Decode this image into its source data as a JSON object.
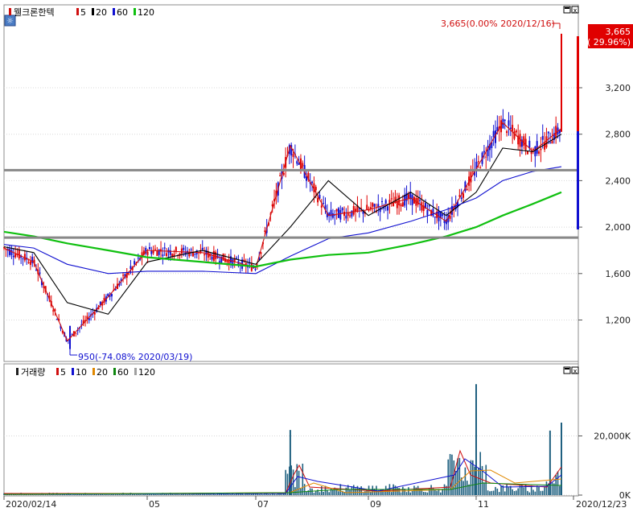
{
  "price_panel": {
    "title": "웰크론한텍",
    "legend": [
      {
        "label": "5",
        "color": "#d01010"
      },
      {
        "label": "20",
        "color": "#000000"
      },
      {
        "label": "60",
        "color": "#1010d0"
      },
      {
        "label": "120",
        "color": "#10c010"
      }
    ],
    "high_annotation": "3,665(0.00% 2020/12/16)",
    "low_annotation": "950(-74.08% 2020/03/19)",
    "current_price": "3,665",
    "current_change": "( 29.96%)"
  },
  "volume_panel": {
    "title": "거래량",
    "legend": [
      {
        "label": "5",
        "color": "#d01010"
      },
      {
        "label": "10",
        "color": "#1010d0"
      },
      {
        "label": "20",
        "color": "#e08800"
      },
      {
        "label": "60",
        "color": "#108810"
      },
      {
        "label": "120",
        "color": "#a0a0a0"
      }
    ]
  },
  "chart_data": [
    {
      "type": "line",
      "title": "웰크론한텍",
      "y_ticks": [
        "3,200",
        "2,800",
        "2,400",
        "2,000",
        "1,600",
        "1,200"
      ],
      "ylim": [
        850,
        3900
      ],
      "x_ticks": [
        "2020/02/14",
        "05",
        "07",
        "09",
        "11",
        "2020/12/23"
      ],
      "horizontal_lines": [
        2490,
        1910
      ],
      "high": 3665,
      "low": 950,
      "series": [
        {
          "name": "5",
          "color": "#d01010",
          "x": [
            "02/14",
            "03/01",
            "03/19",
            "04/10",
            "05/01",
            "06/01",
            "07/01",
            "07/20",
            "08/10",
            "09/01",
            "09/25",
            "10/15",
            "11/01",
            "11/15",
            "12/01",
            "12/16"
          ],
          "values": [
            1820,
            1700,
            1020,
            1400,
            1800,
            1780,
            1650,
            2700,
            2100,
            2150,
            2250,
            2050,
            2500,
            2900,
            2650,
            2850
          ]
        },
        {
          "name": "20",
          "color": "#000000",
          "x": [
            "02/14",
            "03/01",
            "03/19",
            "04/10",
            "05/01",
            "06/01",
            "07/01",
            "07/20",
            "08/10",
            "09/01",
            "09/25",
            "10/15",
            "11/01",
            "11/15",
            "12/01",
            "12/16"
          ],
          "values": [
            1830,
            1780,
            1350,
            1250,
            1700,
            1800,
            1680,
            2000,
            2400,
            2100,
            2300,
            2100,
            2300,
            2680,
            2650,
            2800
          ]
        },
        {
          "name": "60",
          "color": "#1010d0",
          "x": [
            "02/14",
            "03/01",
            "03/19",
            "04/10",
            "05/01",
            "06/01",
            "07/01",
            "07/20",
            "08/10",
            "09/01",
            "09/25",
            "10/15",
            "11/01",
            "11/15",
            "12/01",
            "12/16"
          ],
          "values": [
            1850,
            1820,
            1680,
            1600,
            1620,
            1620,
            1600,
            1750,
            1900,
            1950,
            2050,
            2150,
            2250,
            2400,
            2480,
            2520
          ]
        },
        {
          "name": "120",
          "color": "#10c010",
          "x": [
            "02/14",
            "03/01",
            "03/19",
            "04/10",
            "05/01",
            "06/01",
            "07/01",
            "07/20",
            "08/10",
            "09/01",
            "09/25",
            "10/15",
            "11/01",
            "11/15",
            "12/01",
            "12/16"
          ],
          "values": [
            1960,
            1920,
            1860,
            1800,
            1740,
            1700,
            1660,
            1720,
            1760,
            1780,
            1850,
            1920,
            2000,
            2100,
            2200,
            2300
          ]
        }
      ]
    },
    {
      "type": "bar",
      "title": "거래량",
      "y_ticks": [
        "20,000K",
        "0K"
      ],
      "ylim": [
        0,
        40000
      ],
      "volume_spikes": [
        {
          "x": "07/20",
          "value": 22000
        },
        {
          "x": "11/01",
          "value": 37500
        },
        {
          "x": "12/10",
          "value": 21800
        },
        {
          "x": "12/16",
          "value": 24500
        }
      ]
    }
  ]
}
